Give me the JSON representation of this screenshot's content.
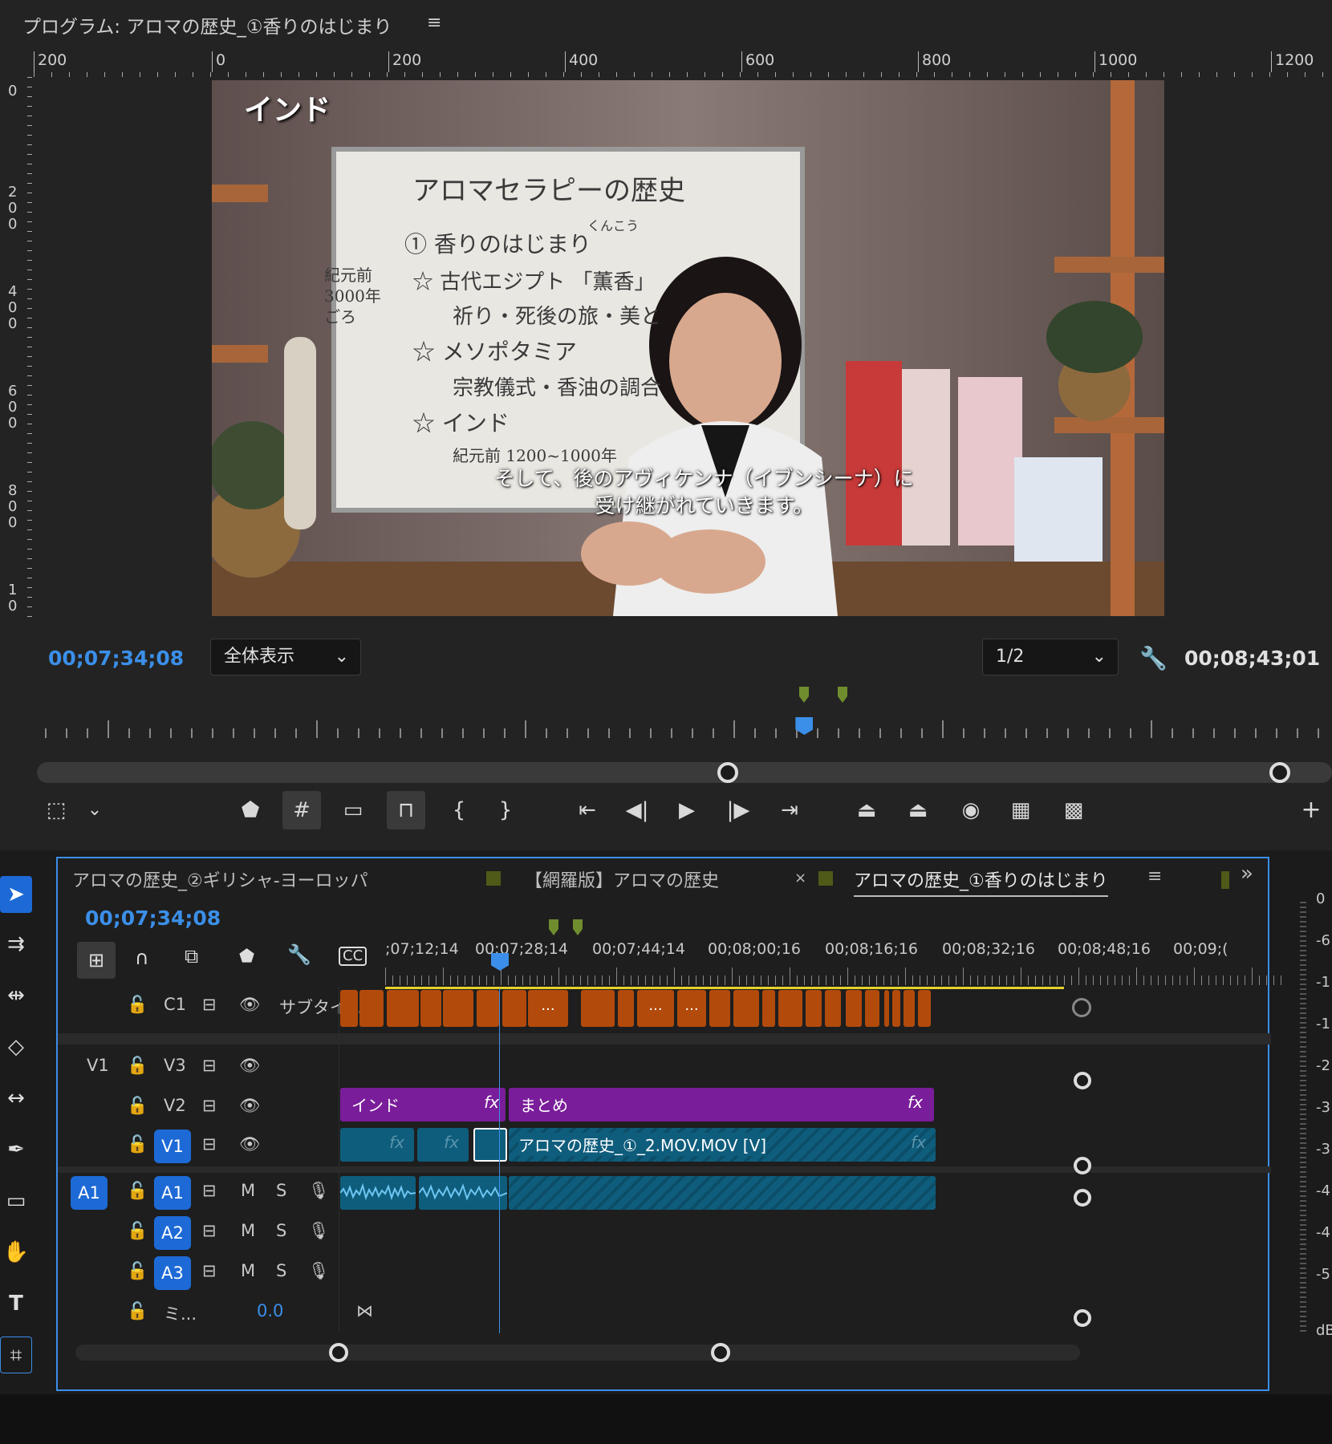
{
  "program_monitor": {
    "title": "プログラム: アロマの歴史_①香りのはじまり",
    "menu_icon": "hamburger-menu-icon",
    "ruler_top": [
      "200",
      "0",
      "200",
      "400",
      "600",
      "800",
      "1000",
      "1200"
    ],
    "ruler_left": [
      "0",
      "200",
      "400",
      "600",
      "800",
      "10"
    ],
    "video": {
      "corner_caption": "インド",
      "board_title": "アロマセラピーの歴史",
      "board_lines": [
        "① 香りのはじまり",
        "紀元前",
        "3000年",
        "ごろ",
        "☆ 古代エジプト 「薫香」",
        "祈り・死後の旅・美と",
        "☆ メソポタミア",
        "宗教儀式・香油の調合",
        "☆ インド",
        "紀元前 1200~1000年"
      ],
      "board_ruby": "くんこう",
      "subtitle_line1": "そして、後のアヴィケンナ（イブンシーナ）に",
      "subtitle_line2": "受け継がれていきます。"
    },
    "current_timecode": "00;07;34;08",
    "zoom_label": "全体表示",
    "resolution_label": "1/2",
    "duration_timecode": "00;08;43;01",
    "playhead_fraction": 0.59,
    "icon_names": [
      "marker-icon",
      "grid-icon",
      "safe-margin-icon",
      "comparison-view-icon",
      "mark-in-icon",
      "mark-out-icon",
      "go-to-in-icon",
      "step-back-icon",
      "play-icon",
      "step-forward-icon",
      "go-to-out-icon",
      "lift-icon",
      "extract-icon",
      "export-frame-icon",
      "insert-icon",
      "multi-camera-icon",
      "add-button-icon"
    ],
    "colors": {
      "timecode_blue": "#3b8fe8",
      "background": "#232323"
    }
  },
  "timeline": {
    "tabs": [
      {
        "label": "アロマの歴史_②ギリシャ-ヨーロッパ",
        "active": false
      },
      {
        "label": "【網羅版】アロマの歴史",
        "active": false
      },
      {
        "label": "アロマの歴史_①香りのはじまり",
        "active": true
      }
    ],
    "close_glyph": "×",
    "overflow_glyph": "»",
    "menu_glyph": "≡",
    "current_timecode": "00;07;34;08",
    "ruler_labels": [
      ";07;12;14",
      "00;07;28;14",
      "00;07;44;14",
      "00;08;00;16",
      "00;08;16;16",
      "00;08;32;16",
      "00;08;48;16",
      "00;09;("
    ],
    "tracks": {
      "c1": {
        "name": "C1",
        "label": "サブタイ..."
      },
      "v3": {
        "src": "V1",
        "name": "V3"
      },
      "v2": {
        "name": "V2"
      },
      "v1": {
        "name": "V1"
      },
      "a1": {
        "src": "A1",
        "name": "A1",
        "m": "M",
        "s": "S"
      },
      "a2": {
        "name": "A2",
        "m": "M",
        "s": "S"
      },
      "a3": {
        "name": "A3",
        "m": "M",
        "s": "S"
      },
      "mix": {
        "name": "ミ...",
        "value": "0.0"
      }
    },
    "clips": {
      "v2_clip1": "インド",
      "v2_clip2": "まとめ",
      "v1_main": "アロマの歴史_①_2.MOV.MOV [V]",
      "fx": "fx",
      "subtitle_ellipsis": "..."
    },
    "colors": {
      "video_clip": "#0f5d7c",
      "graphic_clip": "#7a1d9a",
      "subtitle_clip": "#b24a0b",
      "accent": "#3c8ee8"
    }
  },
  "tools_panel": {
    "tools": [
      "selection-tool-icon",
      "track-select-icon",
      "ripple-edit-icon",
      "razor-icon",
      "slip-icon",
      "pen-icon",
      "rectangle-icon",
      "hand-icon",
      "type-icon",
      "remix-icon"
    ]
  },
  "audio_meter": {
    "labels": [
      "0",
      "-6",
      "-1",
      "-1",
      "-2",
      "-3",
      "-3",
      "-4",
      "-4",
      "-5",
      "dB"
    ]
  }
}
